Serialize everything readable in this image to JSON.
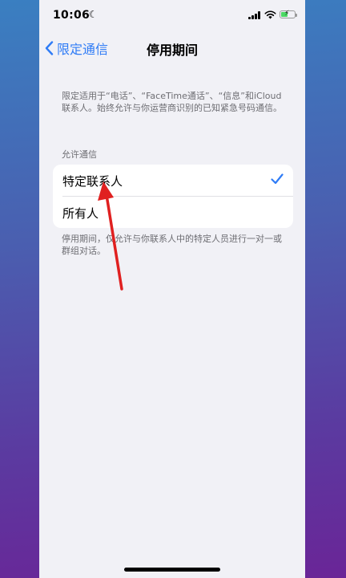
{
  "status_bar": {
    "time": "10:06"
  },
  "nav": {
    "back_label": "限定通信",
    "title": "停用期间"
  },
  "description": "限定适用于“电话”、“FaceTime通话”、“信息”和iCloud联系人。始终允许与你运营商识别的已知紧急号码通信。",
  "section": {
    "header": "允许通信",
    "options": [
      {
        "label": "特定联系人",
        "selected": true
      },
      {
        "label": "所有人",
        "selected": false
      }
    ]
  },
  "footer": "停用期间，仅允许与你联系人中的特定人员进行一对一或群组对话。",
  "colors": {
    "accent": "#2f7cf6",
    "annotation_arrow": "#e02020"
  }
}
